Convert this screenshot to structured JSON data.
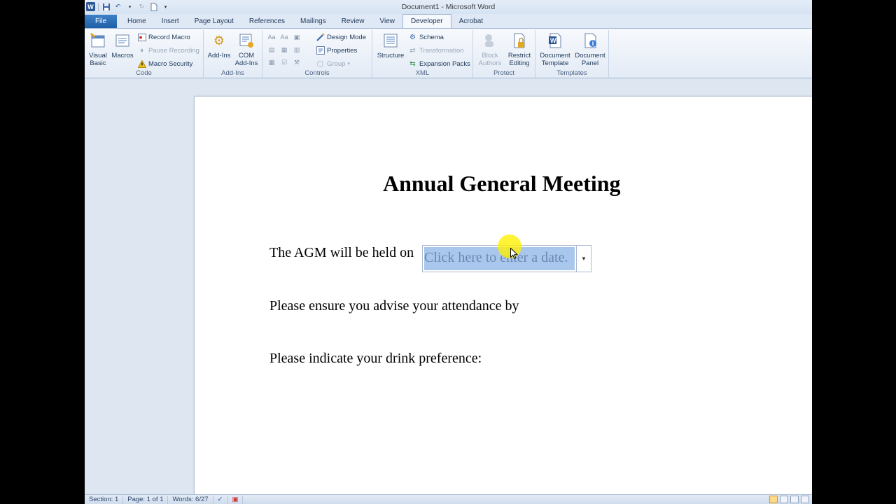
{
  "window": {
    "title": "Document1  -  Microsoft Word"
  },
  "qat": {
    "app_icon": "W"
  },
  "tabs": [
    {
      "label": "File"
    },
    {
      "label": "Home"
    },
    {
      "label": "Insert"
    },
    {
      "label": "Page Layout"
    },
    {
      "label": "References"
    },
    {
      "label": "Mailings"
    },
    {
      "label": "Review"
    },
    {
      "label": "View"
    },
    {
      "label": "Developer"
    },
    {
      "label": "Acrobat"
    }
  ],
  "ribbon": {
    "code": {
      "label": "Code",
      "visual_basic": "Visual Basic",
      "macros": "Macros",
      "record_macro": "Record Macro",
      "pause_recording": "Pause Recording",
      "macro_security": "Macro Security"
    },
    "addins": {
      "label": "Add-Ins",
      "addins": "Add-Ins",
      "com_addins_1": "COM",
      "com_addins_2": "Add-Ins"
    },
    "controls": {
      "label": "Controls",
      "design_mode": "Design Mode",
      "properties": "Properties",
      "group": "Group"
    },
    "xml": {
      "label": "XML",
      "structure": "Structure",
      "schema": "Schema",
      "transformation": "Transformation",
      "expansion_packs": "Expansion Packs"
    },
    "protect": {
      "label": "Protect",
      "block_1": "Block",
      "block_2": "Authors",
      "restrict_1": "Restrict",
      "restrict_2": "Editing"
    },
    "templates": {
      "label": "Templates",
      "doc_template_1": "Document",
      "doc_template_2": "Template",
      "doc_panel_1": "Document",
      "doc_panel_2": "Panel"
    }
  },
  "document": {
    "heading": "Annual General Meeting",
    "line1": "The AGM will be held on",
    "date_placeholder": "Click here to enter a date.",
    "line2": "Please ensure you advise your attendance by",
    "line3": "Please indicate your drink preference:"
  },
  "status": {
    "section": "Section: 1",
    "page": "Page: 1 of 1",
    "words": "Words: 6/27"
  }
}
